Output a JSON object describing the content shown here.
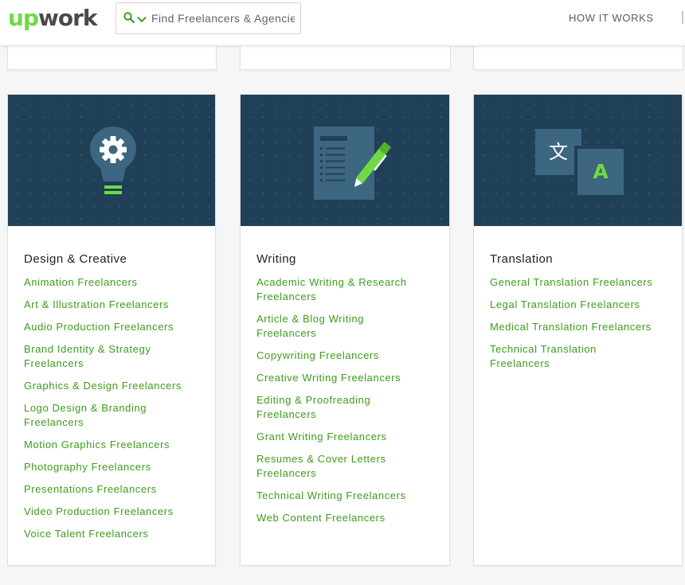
{
  "header": {
    "logo": {
      "up": "up",
      "work": "work"
    },
    "search": {
      "placeholder": "Find Freelancers & Agencies"
    },
    "nav": {
      "how_it_works": "HOW IT WORKS"
    }
  },
  "colors": {
    "brand_green": "#6fda44",
    "link_green": "#3d9c1c",
    "banner_navy": "#1f4057"
  },
  "categories": [
    {
      "title": "Design & Creative",
      "icon": "lightbulb-gear-icon",
      "links": [
        "Animation Freelancers",
        "Art & Illustration Freelancers",
        "Audio Production Freelancers",
        "Brand Identity & Strategy Freelancers",
        "Graphics & Design Freelancers",
        "Logo Design & Branding Freelancers",
        "Motion Graphics Freelancers",
        "Photography Freelancers",
        "Presentations Freelancers",
        "Video Production Freelancers",
        "Voice Talent Freelancers"
      ]
    },
    {
      "title": "Writing",
      "icon": "document-pen-icon",
      "links": [
        "Academic Writing & Research Freelancers",
        "Article & Blog Writing Freelancers",
        "Copywriting Freelancers",
        "Creative Writing Freelancers",
        "Editing & Proofreading Freelancers",
        "Grant Writing Freelancers",
        "Resumes & Cover Letters Freelancers",
        "Technical Writing Freelancers",
        "Web Content Freelancers"
      ]
    },
    {
      "title": "Translation",
      "icon": "translate-icon",
      "icon_glyphs": {
        "source": "文",
        "target": "A"
      },
      "links": [
        "General Translation Freelancers",
        "Legal Translation Freelancers",
        "Medical Translation Freelancers",
        "Technical Translation Freelancers"
      ]
    }
  ]
}
